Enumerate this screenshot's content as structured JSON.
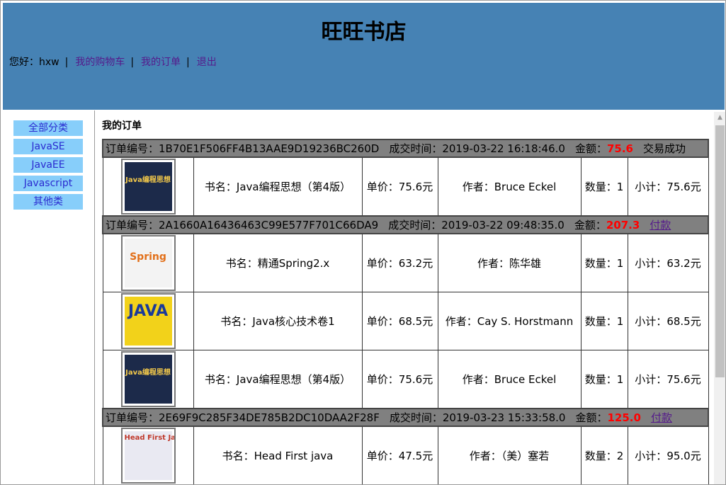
{
  "store": {
    "title": "旺旺书店"
  },
  "user_bar": {
    "greeting": "您好：",
    "username": "hxw",
    "sep": "|",
    "cart": "我的购物车",
    "orders": "我的订单",
    "logout": "退出"
  },
  "categories": [
    "全部分类",
    "JavaSE",
    "JavaEE",
    "Javascript",
    "其他类"
  ],
  "main": {
    "title": "我的订单"
  },
  "labels": {
    "order_no": "订单编号：",
    "time": "成交时间：",
    "amount": "金额：",
    "book": "书名：",
    "price": "单价：",
    "author": "作者：",
    "qty": "数量：",
    "subtotal": "小计："
  },
  "orders": [
    {
      "id": "1B70E1F506FF4B13AAE9D19236BC260D",
      "time": "2019-03-22 16:18:46.0",
      "amount": "75.6",
      "status": "交易成功",
      "items": [
        {
          "cover": "book-cover-java-thinking",
          "cover_text": "Java编程思想",
          "name": "Java编程思想（第4版）",
          "price": "75.6元",
          "author": "Bruce Eckel",
          "qty": "1",
          "subtotal": "75.6元"
        }
      ]
    },
    {
      "id": "2A1660A16436463C99E577F701C66DA9",
      "time": "2019-03-22 09:48:35.0",
      "amount": "207.3",
      "action": "付款",
      "items": [
        {
          "cover": "book-cover-spring",
          "cover_text": "Spring",
          "name": "精通Spring2.x",
          "price": "63.2元",
          "author": "陈华雄",
          "qty": "1",
          "subtotal": "63.2元"
        },
        {
          "cover": "book-cover-java-core",
          "cover_text": "JAVA",
          "name": "Java核心技术卷1",
          "price": "68.5元",
          "author": "Cay S. Horstmann",
          "qty": "1",
          "subtotal": "68.5元"
        },
        {
          "cover": "book-cover-java-thinking",
          "cover_text": "Java编程思想",
          "name": "Java编程思想（第4版）",
          "price": "75.6元",
          "author": "Bruce Eckel",
          "qty": "1",
          "subtotal": "75.6元"
        }
      ]
    },
    {
      "id": "2E69F9C285F34DE785B2DC10DAA2F28F",
      "time": "2019-03-23 15:33:58.0",
      "amount": "125.0",
      "action": "付款",
      "items": [
        {
          "cover": "book-cover-head-first-java",
          "cover_text": "Head First Java",
          "name": "Head First java",
          "price": "47.5元",
          "author": "（美）塞若",
          "qty": "2",
          "subtotal": "95.0元"
        }
      ]
    }
  ],
  "colors": {
    "header_bg": "#4682b4",
    "category_bg": "#87cefa",
    "order_head_bg": "#808080",
    "amount": "#ff0000"
  }
}
